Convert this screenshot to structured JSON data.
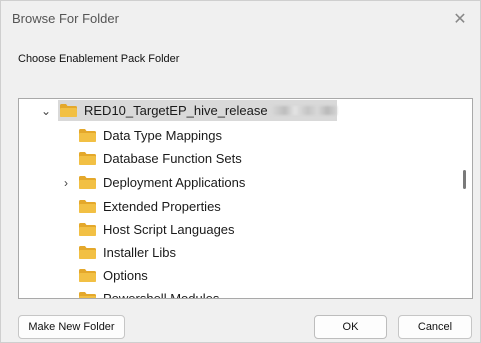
{
  "dialog": {
    "title": "Browse For Folder",
    "instruction": "Choose Enablement Pack Folder"
  },
  "tree": {
    "root": {
      "label": "RED10_TargetEP_hive_release",
      "expanded": true,
      "selected": true
    },
    "items": [
      {
        "label": "Data Type Mappings",
        "expandable": false
      },
      {
        "label": "Database Function Sets",
        "expandable": false
      },
      {
        "label": "Deployment Applications",
        "expandable": true
      },
      {
        "label": "Extended Properties",
        "expandable": false
      },
      {
        "label": "Host Script Languages",
        "expandable": false
      },
      {
        "label": "Installer Libs",
        "expandable": false
      },
      {
        "label": "Options",
        "expandable": false
      },
      {
        "label": "Powershell Modules",
        "expandable": false
      }
    ]
  },
  "buttons": {
    "make_new_folder": "Make New Folder",
    "ok": "OK",
    "cancel": "Cancel"
  },
  "icons": {
    "close": "close-icon",
    "folder": "folder-icon",
    "expand": "chevron-right-icon",
    "collapse": "chevron-down-icon"
  },
  "colors": {
    "folder": "#f2c044",
    "folder_dark": "#e4a82b",
    "selection": "#d9d9d9"
  }
}
